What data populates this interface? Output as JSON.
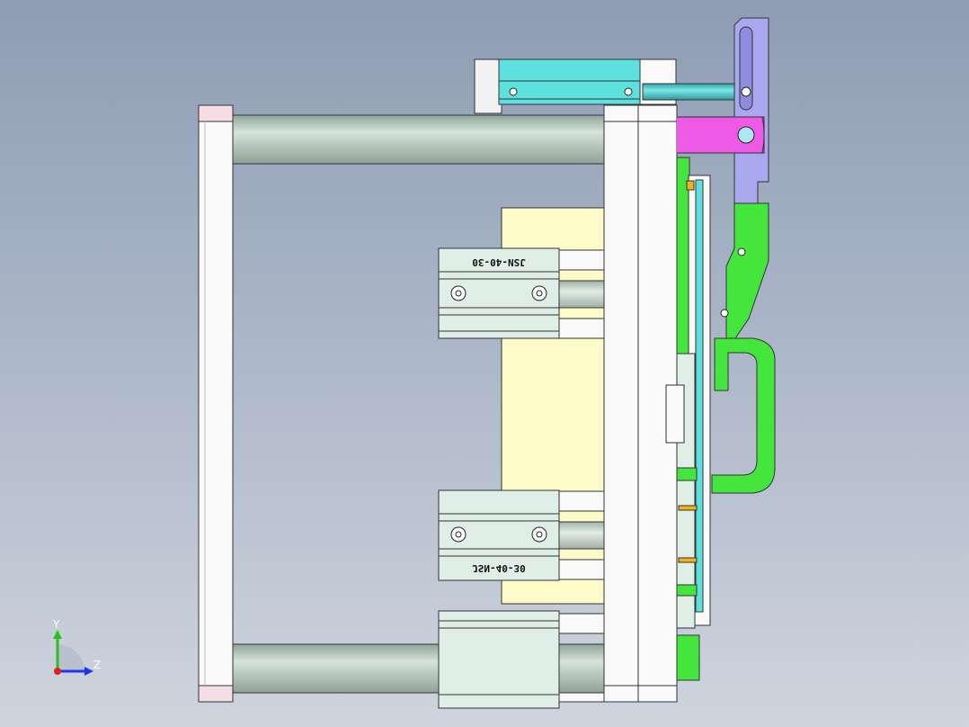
{
  "viewport": {
    "background_top": "#8e9db4",
    "background_bottom": "#cfd5de"
  },
  "colors": {
    "tie_bar": "#aebfb4",
    "platen": "#fafafa",
    "cylinder_body": "#dfeee6",
    "mold_plate": "#fdfcc8",
    "actuator": "#5ee0df",
    "link": "#a9a7ee",
    "bracket": "#ee5ae6",
    "arm": "#44e63e",
    "pin": "#f1b418"
  },
  "cylinders": {
    "upper_label": "JSN-40-30",
    "lower_label": "JSN-40-30"
  },
  "triad": {
    "y_label": "Y",
    "z_label": "Z"
  }
}
